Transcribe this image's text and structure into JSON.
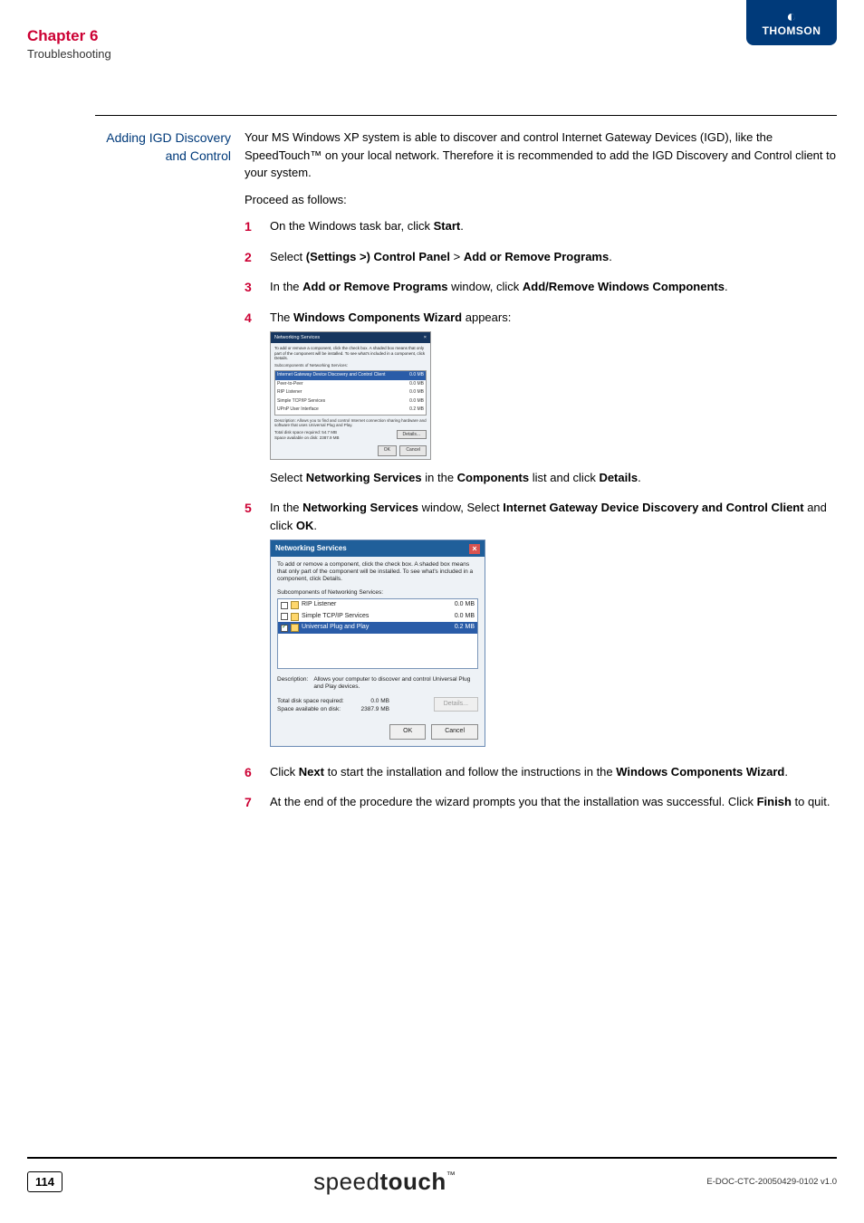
{
  "header": {
    "chapter_title": "Chapter 6",
    "chapter_subtitle": "Troubleshooting",
    "brand": "THOMSON"
  },
  "section": {
    "side_heading_l1": "Adding IGD Discovery",
    "side_heading_l2": "and Control",
    "intro_para": "Your MS Windows XP system is able to discover and control Internet Gateway Devices (IGD), like the SpeedTouch™ on your local network. Therefore it is recommended to add the IGD Discovery and Control client to your system.",
    "proceed_label": "Proceed as follows:",
    "steps": {
      "n1": "1",
      "s1_pre": "On the Windows task bar, click ",
      "s1_b": "Start",
      "s1_post": ".",
      "n2": "2",
      "s2_pre": "Select ",
      "s2_b1": "(Settings >) Control Panel",
      "s2_gt": " > ",
      "s2_b2": "Add or Remove Programs",
      "s2_post": ".",
      "n3": "3",
      "s3_pre": "In the ",
      "s3_b1": "Add or Remove Programs",
      "s3_mid": " window, click ",
      "s3_b2": "Add/Remove Windows Components",
      "s3_post": ".",
      "n4": "4",
      "s4_pre": "The ",
      "s4_b": "Windows Components Wizard",
      "s4_post": " appears:",
      "s4_after_pre": "Select ",
      "s4_after_b1": "Networking Services",
      "s4_after_mid": " in the ",
      "s4_after_b2": "Components",
      "s4_after_mid2": " list and click ",
      "s4_after_b3": "Details",
      "s4_after_post": ".",
      "n5": "5",
      "s5_pre": "In the ",
      "s5_b1": "Networking Services",
      "s5_mid": " window, Select ",
      "s5_b2": "Internet Gateway Device Discovery and Control Client",
      "s5_mid2": " and click ",
      "s5_b3": "OK",
      "s5_post": ".",
      "n6": "6",
      "s6_pre": "Click ",
      "s6_b1": "Next",
      "s6_mid": " to start the installation and follow the instructions in the ",
      "s6_b2": "Windows Components Wizard",
      "s6_post": ".",
      "n7": "7",
      "s7_pre": "At the end of the procedure the wizard prompts you that the installation was successful. Click ",
      "s7_b": "Finish",
      "s7_post": " to quit."
    }
  },
  "wizard1": {
    "title": "Networking Services",
    "hint": "To add or remove a component, click the check box. A shaded box means that only part of the component will be installed. To see what's included in a component, click Details.",
    "sublabel": "Subcomponents of Networking Services:",
    "rows": [
      {
        "name": "Internet Gateway Device Discovery and Control Client",
        "size": "0.0 MB",
        "sel": true
      },
      {
        "name": "Peer-to-Peer",
        "size": "0.0 MB"
      },
      {
        "name": "RIP Listener",
        "size": "0.0 MB"
      },
      {
        "name": "Simple TCP/IP Services",
        "size": "0.0 MB"
      },
      {
        "name": "UPnP User Interface",
        "size": "0.2 MB"
      }
    ],
    "desc_label": "Description:",
    "desc_text": "Allows you to find and control Internet connection sharing hardware and software that uses Universal Plug and Play.",
    "total_label": "Total disk space required:",
    "total_val": "54.7 MB",
    "avail_label": "Space available on disk:",
    "avail_val": "2387.9 MB",
    "details_btn": "Details...",
    "ok_btn": "OK",
    "cancel_btn": "Cancel"
  },
  "wizard2": {
    "title": "Networking Services",
    "hint": "To add or remove a component, click the check box. A shaded box means that only part of the component will be installed. To see what's included in a component, click Details.",
    "sublabel": "Subcomponents of Networking Services:",
    "rows": [
      {
        "name": "RIP Listener",
        "size": "0.0 MB",
        "checked": false
      },
      {
        "name": "Simple TCP/IP Services",
        "size": "0.0 MB",
        "checked": false
      },
      {
        "name": "Universal Plug and Play",
        "size": "0.2 MB",
        "checked": true,
        "sel": true
      }
    ],
    "desc_label": "Description:",
    "desc_text": "Allows your computer to discover and control Universal Plug and Play devices.",
    "total_label": "Total disk space required:",
    "total_val": "0.0 MB",
    "avail_label": "Space available on disk:",
    "avail_val": "2387.9 MB",
    "details_btn": "Details...",
    "ok_btn": "OK",
    "cancel_btn": "Cancel"
  },
  "footer": {
    "page_number": "114",
    "logo_thin": "speed",
    "logo_bold": "touch",
    "tm": "™",
    "doc_id": "E-DOC-CTC-20050429-0102 v1.0"
  }
}
